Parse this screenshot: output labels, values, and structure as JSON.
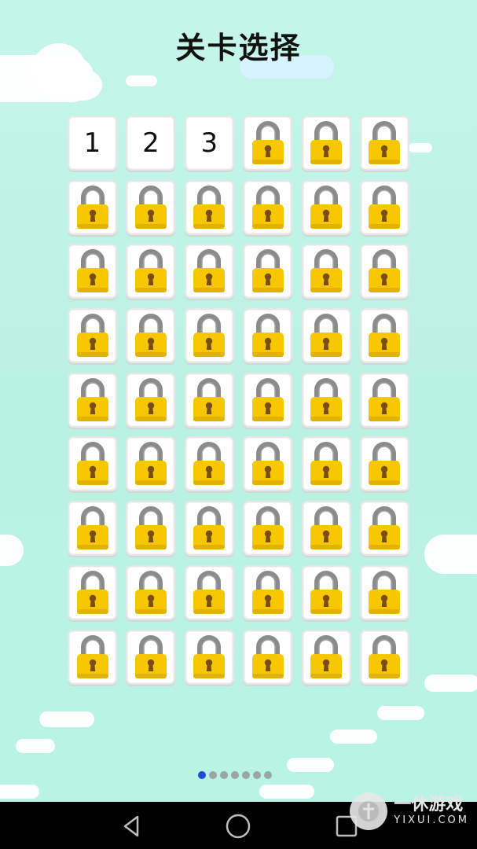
{
  "header": {
    "title": "关卡选择"
  },
  "levels": {
    "unlocked": [
      "1",
      "2",
      "3"
    ],
    "total": 54,
    "locked_icon": "padlock-icon"
  },
  "pagination": {
    "pages": 7,
    "current": 1
  },
  "navbar": {
    "back_icon": "back-triangle-icon",
    "home_icon": "home-circle-icon"
  },
  "watermark": {
    "name": "一休游戏",
    "site": "YIXUI.COM"
  },
  "colors": {
    "background": "#baf3e3",
    "lock_body": "#f7c800",
    "lock_shackle": "#8a8a8a",
    "active_dot": "#1f4bd6"
  }
}
